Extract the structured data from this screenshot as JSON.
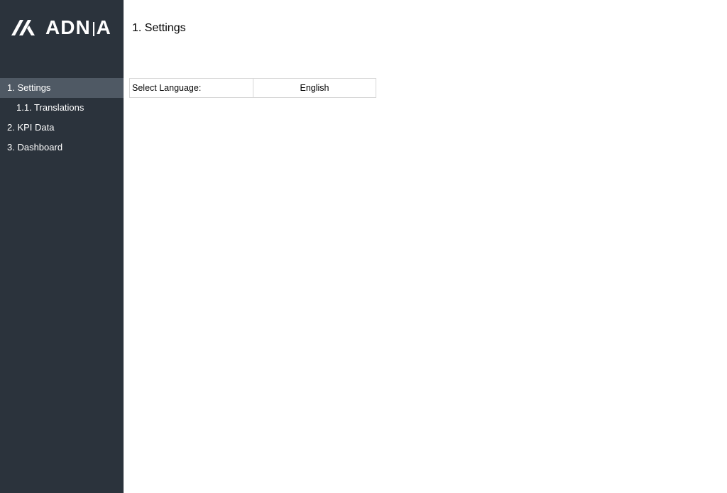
{
  "brand": {
    "name_left": "ADN",
    "name_right": "A",
    "mark_icon": "adnia-logo-mark",
    "sidebar_color": "#2b333c",
    "active_color": "#4f5964"
  },
  "sidebar": {
    "items": [
      {
        "label": "1. Settings",
        "active": true
      },
      {
        "label": "1.1. Translations"
      },
      {
        "label": "2. KPI Data"
      },
      {
        "label": "3. Dashboard"
      }
    ]
  },
  "main": {
    "title": "1. Settings",
    "language": {
      "label": "Select Language:",
      "value": "English"
    }
  }
}
